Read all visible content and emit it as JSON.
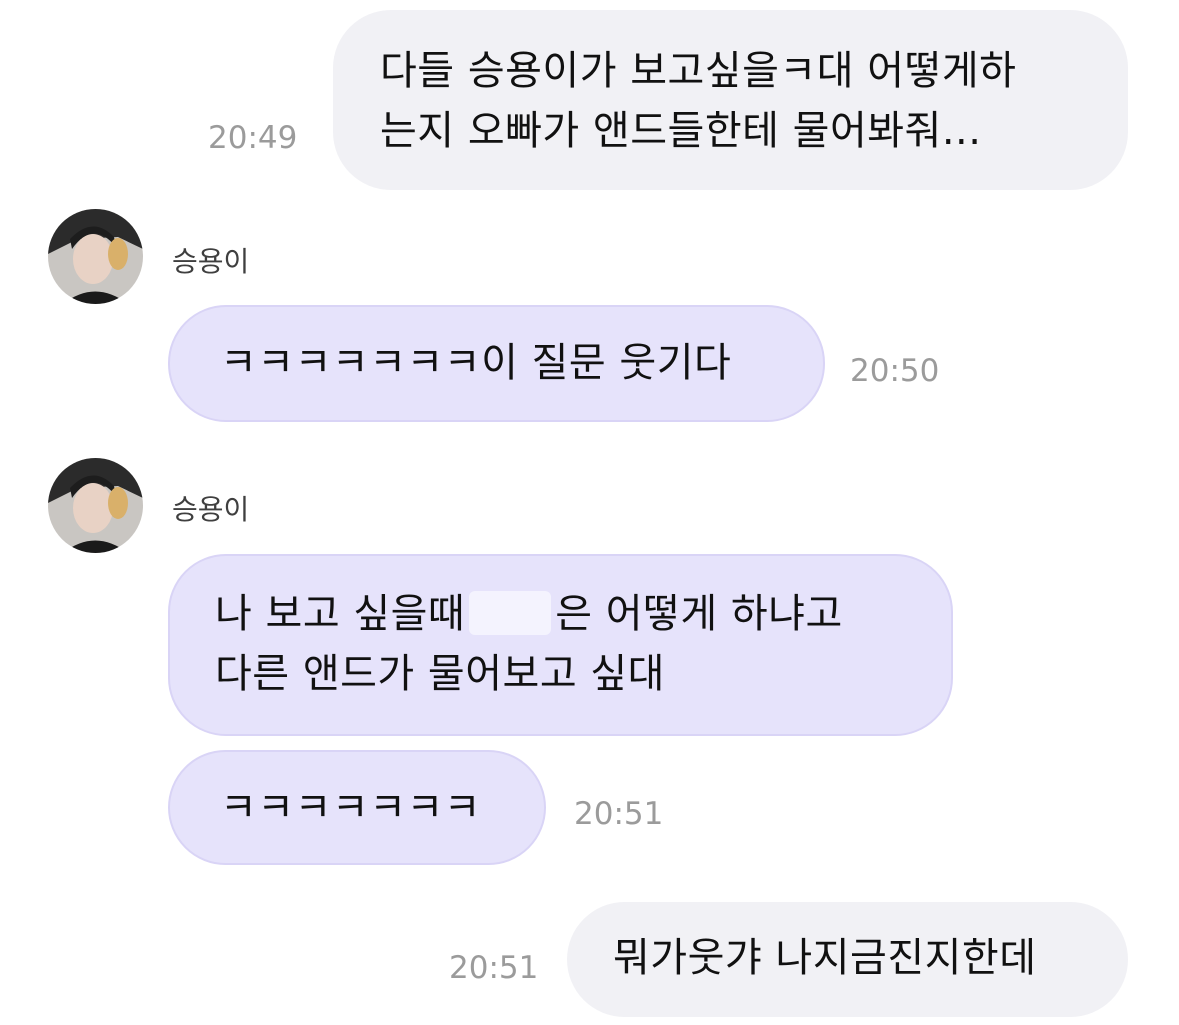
{
  "conversation": {
    "messages": [
      {
        "direction": "outgoing",
        "lines": [
          "다들 승용이가 보고싶을ㅋ대 어떻게하",
          "는지 오빠가 앤드들한테 물어봐줘..."
        ],
        "time": "20:49"
      },
      {
        "direction": "incoming",
        "sender": "승용이",
        "avatar_icon": "profile-photo",
        "lines": [
          "ㅋㅋㅋㅋㅋㅋㅋ이 질문 웃기다"
        ],
        "time": "20:50"
      },
      {
        "direction": "incoming",
        "sender": "승용이",
        "avatar_icon": "profile-photo",
        "line1_before": "나 보고 싶을때",
        "line1_after": "은 어떻게 하냐고",
        "line2": "다른 앤드가 물어보고 싶대"
      },
      {
        "direction": "incoming",
        "lines": [
          "ㅋㅋㅋㅋㅋㅋㅋ"
        ],
        "time": "20:51"
      },
      {
        "direction": "outgoing",
        "lines": [
          "뭐가웃갸 나지금진지한데"
        ],
        "time": "20:51"
      }
    ]
  },
  "colors": {
    "outgoing_bubble": "#f1f1f5",
    "incoming_bubble": "#e6e3fb",
    "incoming_border": "#d9d4f6",
    "timestamp": "#9b9b9b",
    "sender_name": "#3f3f3f"
  }
}
